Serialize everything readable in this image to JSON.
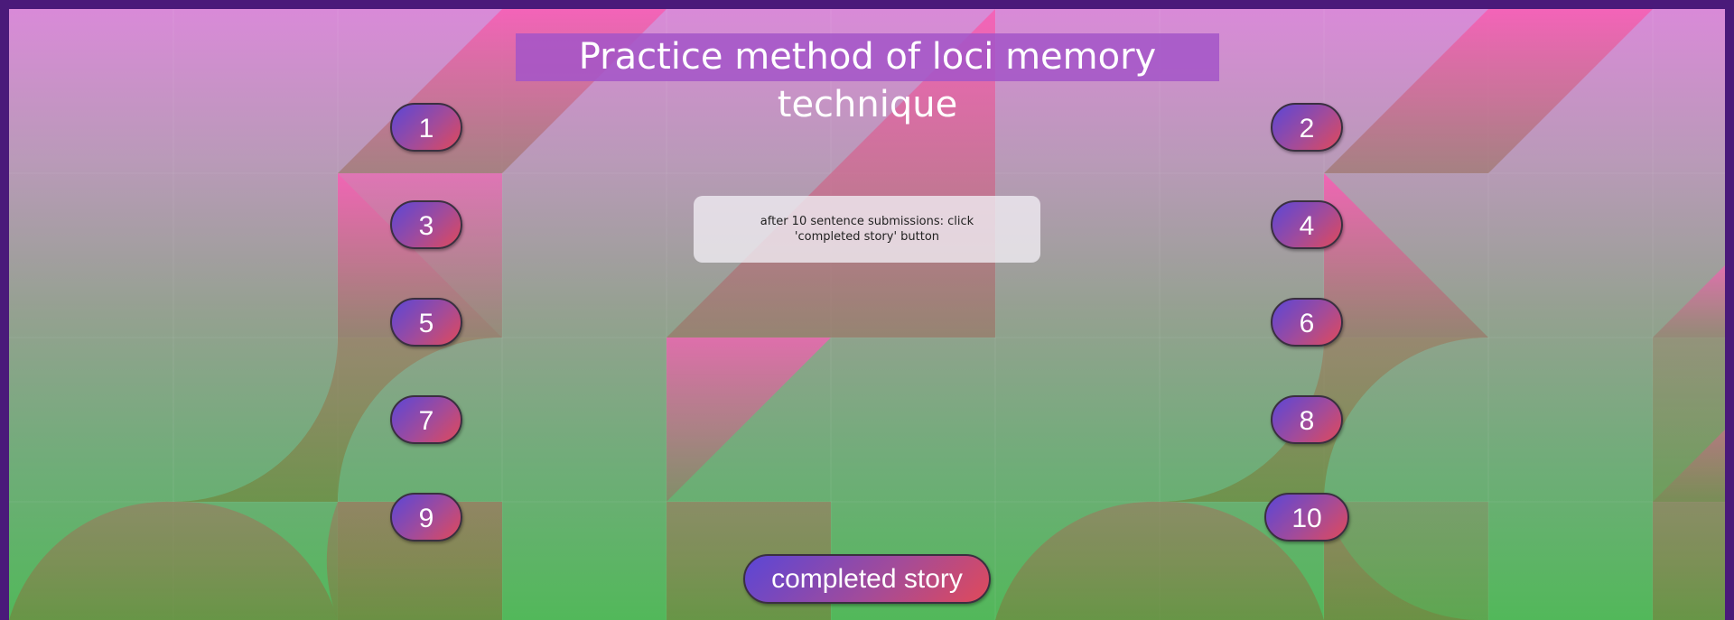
{
  "title": "Practice method of loci memory technique",
  "loci_buttons": [
    "1",
    "2",
    "3",
    "4",
    "5",
    "6",
    "7",
    "8",
    "9",
    "10"
  ],
  "instruction": "after 10 sentence submissions: click 'completed story' button",
  "completed_button": "completed story",
  "colors": {
    "frame_border": "#4a1a7a",
    "title_bg": "#a355c8",
    "button_gradient_start": "#5b46d6",
    "button_gradient_end": "#e04a5a",
    "pink_shape": "#f060b0",
    "olive_shape": "#7a8a48"
  }
}
